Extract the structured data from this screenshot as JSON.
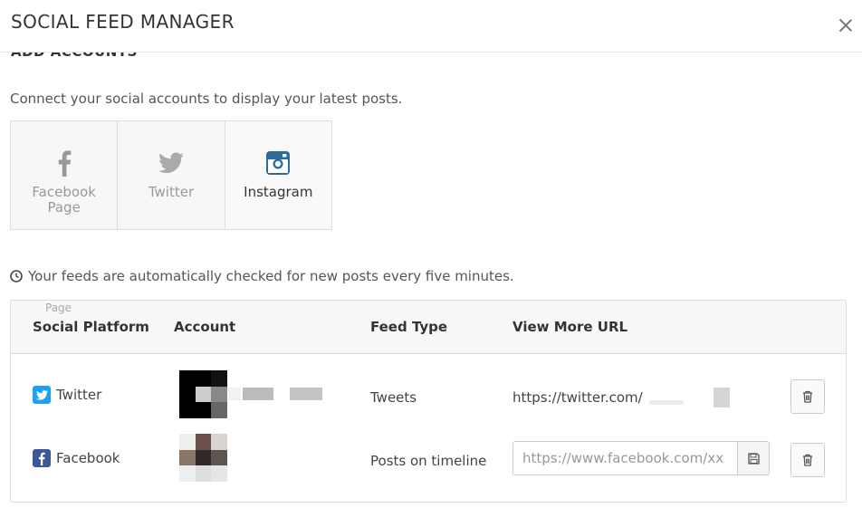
{
  "header": {
    "title": "SOCIAL FEED MANAGER"
  },
  "section": {
    "heading": "ADD ACCOUNTS",
    "intro": "Connect your social accounts to display your latest posts."
  },
  "connect_buttons": [
    {
      "label": "Facebook Page",
      "icon": "facebook-icon",
      "state": "enabled"
    },
    {
      "label": "Twitter",
      "icon": "twitter-icon",
      "state": "disabled"
    },
    {
      "label": "Instagram",
      "icon": "instagram-icon",
      "state": "active"
    }
  ],
  "note": "Your feeds are automatically checked for new posts every five minutes.",
  "table": {
    "ghost_text": "Page",
    "headers": [
      "Social Platform",
      "Account",
      "Feed Type",
      "View More URL"
    ],
    "rows": [
      {
        "platform": "Twitter",
        "feed_type": "Tweets",
        "url_text": "https://twitter.com/"
      },
      {
        "platform": "Facebook",
        "feed_type": "Posts on timeline",
        "url_value": "https://www.facebook.com/xx"
      }
    ]
  },
  "colors": {
    "twitter": "#1da1f2",
    "facebook": "#3b5998",
    "instagram": "#2a6a9c",
    "muted_icon": "#999999"
  }
}
